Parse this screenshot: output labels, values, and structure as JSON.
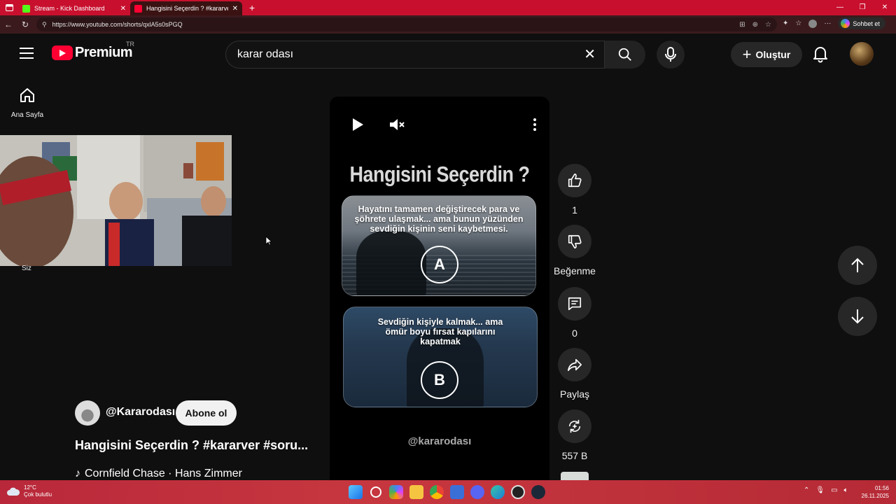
{
  "browser": {
    "tabs": [
      {
        "title": "Stream - Kick Dashboard",
        "favicon_color": "#53fc18"
      },
      {
        "title": "Hangisini Seçerdin ? #kararver #so",
        "favicon_color": "#ff0033"
      }
    ],
    "url": "https://www.youtube.com/shorts/qxlA5s0sPGQ",
    "copilot_label": "Sohbet et"
  },
  "header": {
    "logo_text": "Premium",
    "country_code": "TR",
    "search_value": "karar odası",
    "create_label": "Oluştur"
  },
  "guide": {
    "home_label": "Ana Sayfa",
    "you_label": "Siz"
  },
  "short": {
    "overlay_title": "Hangisini Seçerdin ?",
    "option_a_text": "Hayatını tamamen değiştirecek para ve şöhrete ulaşmak... ama bunun yüzünden sevdiğin kişinin seni kaybetmesi.",
    "option_a_letter": "A",
    "option_b_text": "Sevdiğin kişiyle kalmak... ama ömür boyu fırsat kapılarını kapatmak",
    "option_b_letter": "B",
    "watermark": "@kararodası"
  },
  "actions": {
    "like_count": "1",
    "dislike_label": "Beğenme",
    "comment_count": "0",
    "share_label": "Paylaş",
    "remix_count": "557 B"
  },
  "channel": {
    "handle": "@Kararodası",
    "subscribe_label": "Abone ol",
    "video_title": "Hangisini Seçerdin ? #kararver #soru...",
    "music": "Cornfield Chase · Hans Zimmer"
  },
  "taskbar": {
    "temperature": "12°C",
    "weather": "Çok bulutlu",
    "time": "01:56",
    "date": "26.11.2025"
  }
}
